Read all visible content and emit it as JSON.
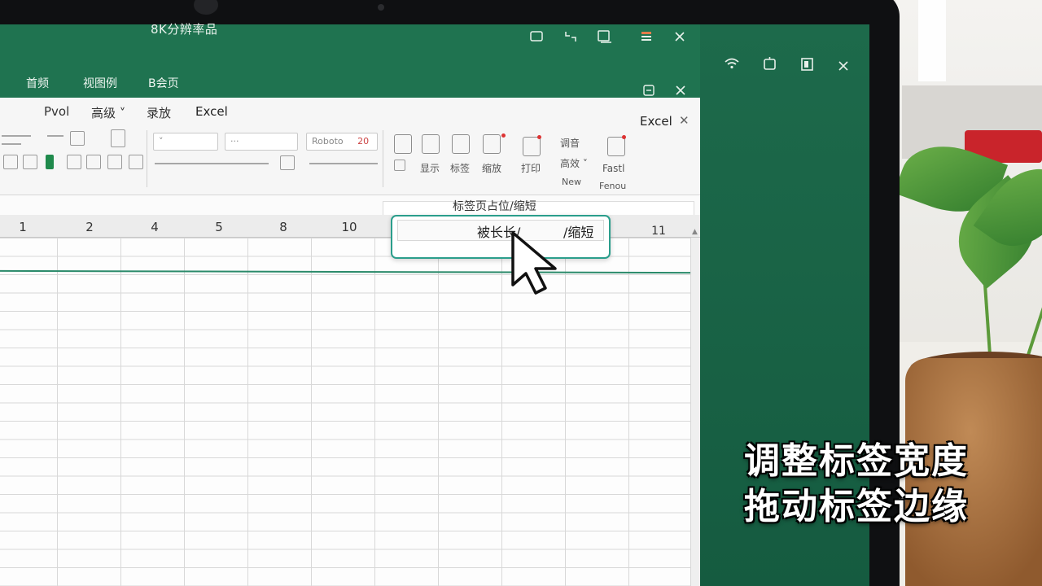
{
  "window": {
    "title": "8K分辨率品",
    "controls": [
      "restore",
      "collapse",
      "present",
      "sheet",
      "close"
    ],
    "outer_controls": [
      "wifi",
      "window",
      "panel",
      "close"
    ]
  },
  "menubar": {
    "items": [
      "首频",
      "视图例",
      "B会页"
    ]
  },
  "ribbon": {
    "tabs": [
      "Pvol",
      "高级",
      "录放",
      "Excel"
    ],
    "tab_dropdown": "高级 ˅",
    "badge": "Excel",
    "font_box": "Roboto",
    "font_size": "20",
    "dropdown_value": "···",
    "group_labels": [
      "显示",
      "标签",
      "缩放",
      "打印"
    ],
    "right_group": [
      "调音",
      "高效 ˅",
      "New"
    ],
    "right_labels": [
      "Fastl",
      "Fenou"
    ]
  },
  "hint": {
    "label": "标签页占位/缩短"
  },
  "columns": [
    "1",
    "2",
    "4",
    "5",
    "8",
    "10",
    "11"
  ],
  "rename_box": {
    "left_text": "被长长/",
    "right_text": "/缩短"
  },
  "caption": {
    "line1": "调整标签宽度",
    "line2": "拖动标签边缘"
  },
  "colors": {
    "excel_green": "#1f7350",
    "accent_teal": "#2b9e8c",
    "grid_line": "#d8d8d8"
  }
}
